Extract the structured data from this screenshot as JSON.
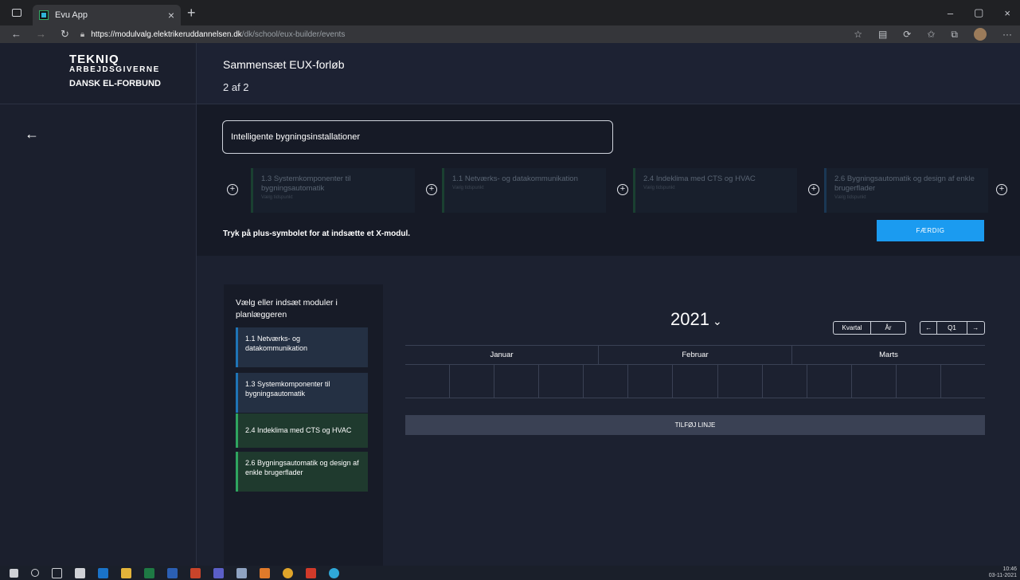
{
  "browser": {
    "tab_title": "Evu App",
    "tab_close": "×",
    "new_tab": "+",
    "url_host": "https://modulvalg.elektrikeruddannelsen.dk",
    "url_path": "/dk/school/eux-builder/events",
    "win_min": "–",
    "win_restore": "▢",
    "win_close": "×"
  },
  "logo": {
    "line1": "TEKNIQ",
    "line2": "ARBEJDSGIVERNE",
    "line3": "DANSK EL-FORBUND"
  },
  "header": {
    "title": "Sammensæt EUX-forløb",
    "step": "2 af 2"
  },
  "builder": {
    "course_name": "Intelligente bygningsinstallationer",
    "modules": [
      {
        "name": "1.3 Systemkomponenter til bygningsautomatik",
        "sub": "Vælg tidspunkt",
        "color": "green"
      },
      {
        "name": "1.1 Netværks- og datakommunikation",
        "sub": "Vælg tidspunkt",
        "color": "green"
      },
      {
        "name": "2.4 Indeklima med CTS og HVAC",
        "sub": "Vælg tidspunkt",
        "color": "green"
      },
      {
        "name": "2.6 Bygningsautomatik og design af enkle brugerflader",
        "sub": "Vælg tidspunkt",
        "color": "blue"
      }
    ],
    "hint": "Tryk på plus-symbolet for at indsætte et X-modul.",
    "done_label": "FÆRDIG"
  },
  "planner": {
    "panel_heading": "Vælg eller indsæt moduler i planlæggeren",
    "panel_modules": [
      {
        "name": "1.1 Netværks- og datakommunikation",
        "color": "blue"
      },
      {
        "name": "1.3 Systemkomponenter til bygningsautomatik",
        "color": "blue"
      },
      {
        "name": "2.4 Indeklima med CTS og HVAC",
        "color": "green"
      },
      {
        "name": "2.6 Bygningsautomatik og design af enkle brugerflader",
        "color": "green"
      }
    ],
    "year": "2021",
    "view_kvartal": "Kvartal",
    "view_aar": "År",
    "prev": "←",
    "quarter": "Q1",
    "next": "→",
    "months": [
      "Januar",
      "Februar",
      "Marts"
    ],
    "add_line": "TILFØJ LINJE"
  },
  "taskbar": {
    "clock_time": "10:46",
    "clock_date": "03-11-2021"
  }
}
